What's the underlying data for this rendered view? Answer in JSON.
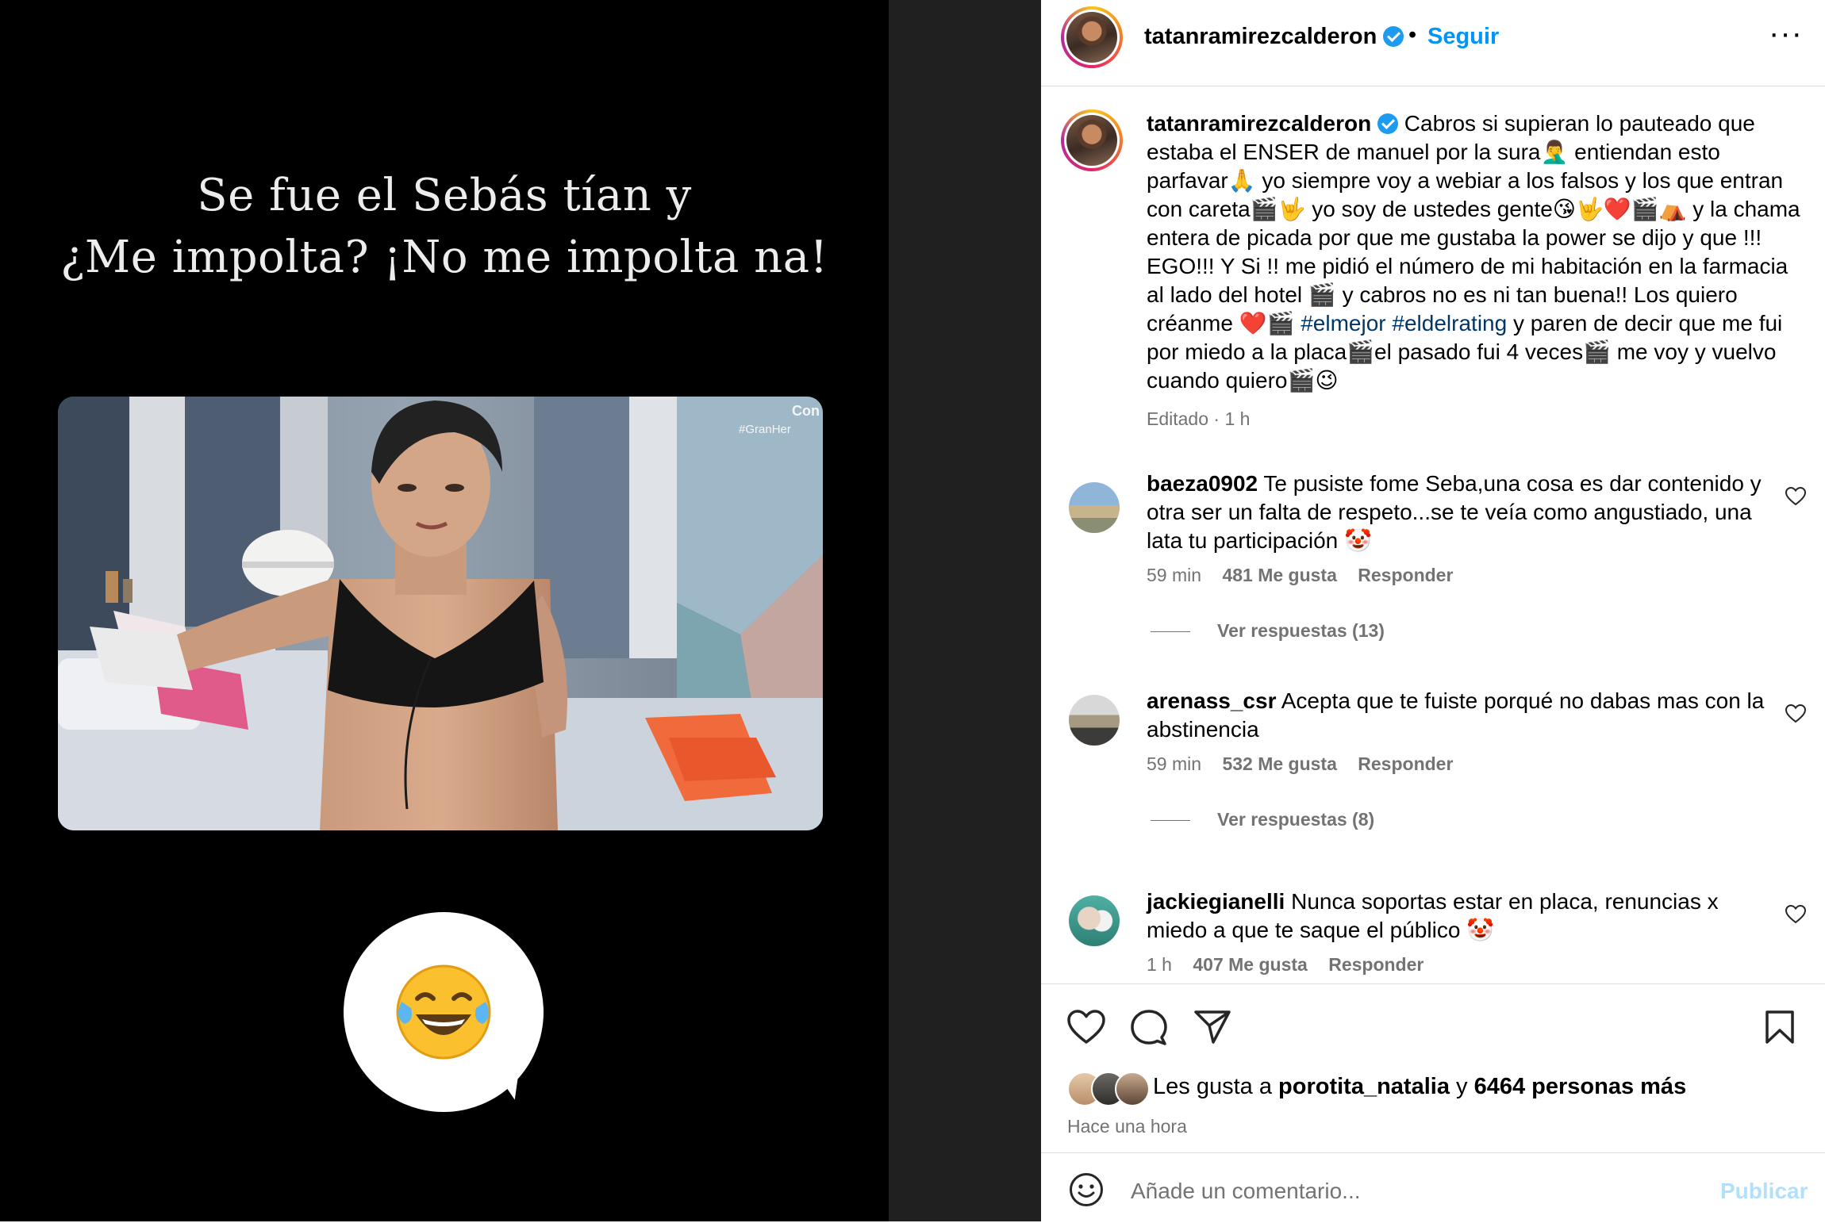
{
  "media": {
    "caption_line1": "Se fue el Sebás tían y",
    "caption_line2": "¿Me impolta? ¡No me impolta na!",
    "video_watermark_line1": "Con",
    "video_watermark_line2": "#GranHer",
    "sticker_emoji": "😂"
  },
  "header": {
    "username": "tatanramirezcalderon",
    "separator": "•",
    "follow_label": "Seguir",
    "more_label": "···"
  },
  "post": {
    "username": "tatanramirezcalderon",
    "caption_part1": "Cabros si supieran lo pauteado que estaba el ENSER de manuel por la sura🤦‍♂️ entiendan esto parfavar🙏 yo siempre voy a webiar a los falsos y los que entran con careta🎬🤟 yo soy de ustedes gente😘🤟❤️🎬⛺ y la chama entera de picada por que me gustaba la power se dijo y que !!! EGO!!! Y Si !! me pidió el número de mi habitación en la farmacia al lado del hotel 🎬 y cabros no es ni tan buena!! Los quiero créanme ❤️🎬",
    "hashtag1": "#elmejor",
    "hashtag2": "#eldelrating",
    "caption_part2": "y paren de decir que me fui por miedo a la placa🎬el pasado fui 4 veces🎬 me voy y vuelvo cuando quiero🎬😉",
    "meta": "Editado · 1 h"
  },
  "comments": [
    {
      "username": "baeza0902",
      "text": "Te pusiste fome Seba,una cosa es dar contenido y otra ser un falta de respeto...se te veía como angustiado, una lata tu participación 🤡",
      "time": "59 min",
      "likes": "481 Me gusta",
      "reply_label": "Responder",
      "replies_label": "Ver respuestas (13)"
    },
    {
      "username": "arenass_csr",
      "text": "Acepta que te fuiste porqué no dabas mas con la abstinencia",
      "time": "59 min",
      "likes": "532 Me gusta",
      "reply_label": "Responder",
      "replies_label": "Ver respuestas (8)"
    },
    {
      "username": "jackiegianelli",
      "text": "Nunca soportas estar en placa, renuncias x miedo a que te saque el público 🤡",
      "time": "1 h",
      "likes": "407 Me gusta",
      "reply_label": "Responder"
    }
  ],
  "likes": {
    "prefix": "Les gusta a",
    "user": "porotita_natalia",
    "conj": "y",
    "others": "6464 personas más"
  },
  "time_ago": "Hace una hora",
  "comment_box": {
    "placeholder": "Añade un comentario...",
    "publish_label": "Publicar"
  },
  "colors": {
    "link_blue": "#0095f6",
    "hashtag_blue": "#00376b",
    "muted_text": "#737373",
    "publish_disabled": "#b2dffc",
    "divider": "#dbdbdb"
  },
  "icons": [
    "heart-icon",
    "comment-icon",
    "share-icon",
    "bookmark-icon",
    "emoji-icon",
    "verified-badge-icon",
    "more-options-icon"
  ]
}
